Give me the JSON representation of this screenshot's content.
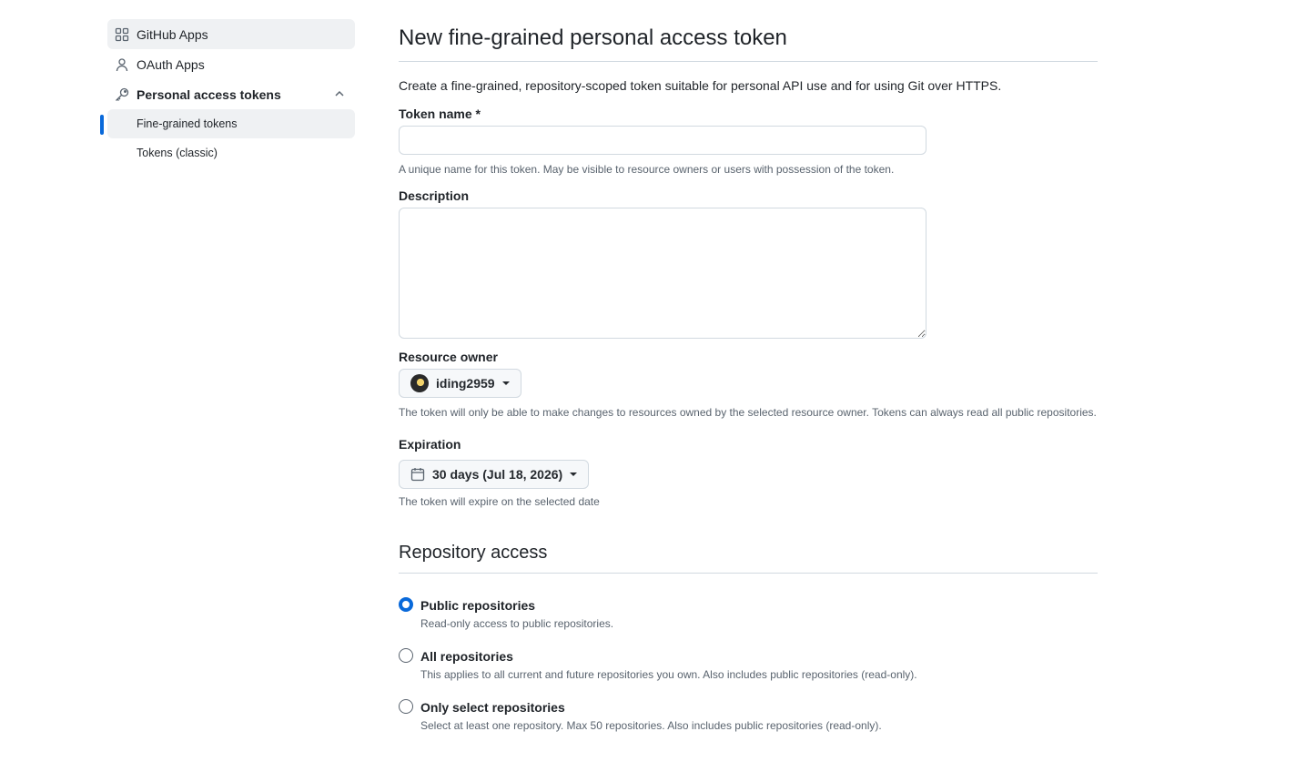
{
  "sidebar": {
    "items": [
      {
        "label": "GitHub Apps",
        "icon": "apps-icon"
      },
      {
        "label": "OAuth Apps",
        "icon": "person-icon"
      },
      {
        "label": "Personal access tokens",
        "icon": "key-icon"
      }
    ],
    "sub_items": [
      {
        "label": "Fine-grained tokens"
      },
      {
        "label": "Tokens (classic)"
      }
    ]
  },
  "main": {
    "title": "New fine-grained personal access token",
    "intro": "Create a fine-grained, repository-scoped token suitable for personal API use and for using Git over HTTPS.",
    "token_name": {
      "label": "Token name *",
      "value": "",
      "note": "A unique name for this token. May be visible to resource owners or users with possession of the token."
    },
    "description": {
      "label": "Description",
      "value": ""
    },
    "resource_owner": {
      "label": "Resource owner",
      "value": "iding2959",
      "note": "The token will only be able to make changes to resources owned by the selected resource owner. Tokens can always read all public repositories."
    },
    "expiration": {
      "label": "Expiration",
      "value": "30 days (Jul 18, 2026)",
      "note": "The token will expire on the selected date"
    },
    "repository_access": {
      "title": "Repository access",
      "options": [
        {
          "label": "Public repositories",
          "note": "Read-only access to public repositories.",
          "checked": true
        },
        {
          "label": "All repositories",
          "note": "This applies to all current and future repositories you own. Also includes public repositories (read-only).",
          "checked": false
        },
        {
          "label": "Only select repositories",
          "note": "Select at least one repository. Max 50 repositories. Also includes public repositories (read-only).",
          "checked": false
        }
      ]
    }
  },
  "colors": {
    "accent": "#0969da",
    "muted_text": "#59636e",
    "border": "#d1d9e0",
    "active_bg": "#eff1f3"
  }
}
